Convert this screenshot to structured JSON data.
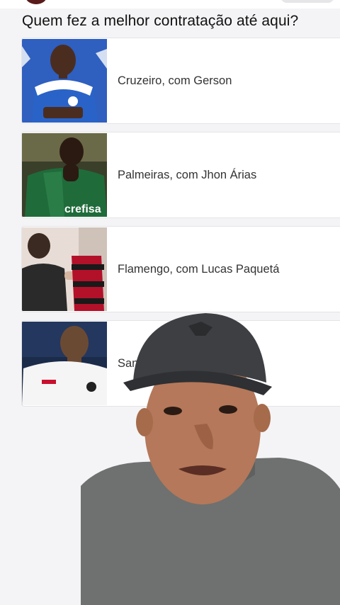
{
  "poll": {
    "question": "Quem fez a melhor contratação até aqui?",
    "options": [
      {
        "label": "Cruzeiro, com Gerson",
        "image": "gerson-cruzeiro-photo"
      },
      {
        "label": "Palmeiras, com Jhon Árias",
        "image": "arias-palmeiras-photo"
      },
      {
        "label": "Flamengo, com Lucas Paquetá",
        "image": "paqueta-flamengo-photo"
      },
      {
        "label": "Santos, com ...",
        "image": "santos-player-photo"
      }
    ]
  },
  "colors": {
    "cruzeiro_blue": "#2a63c8",
    "palmeiras_green": "#1f6b3a",
    "flamengo_red": "#c8102e",
    "santos_white": "#f5f5f5"
  },
  "overlay": {
    "type": "presenter-webcam",
    "subject": "man with dark cap and grey t-shirt"
  }
}
